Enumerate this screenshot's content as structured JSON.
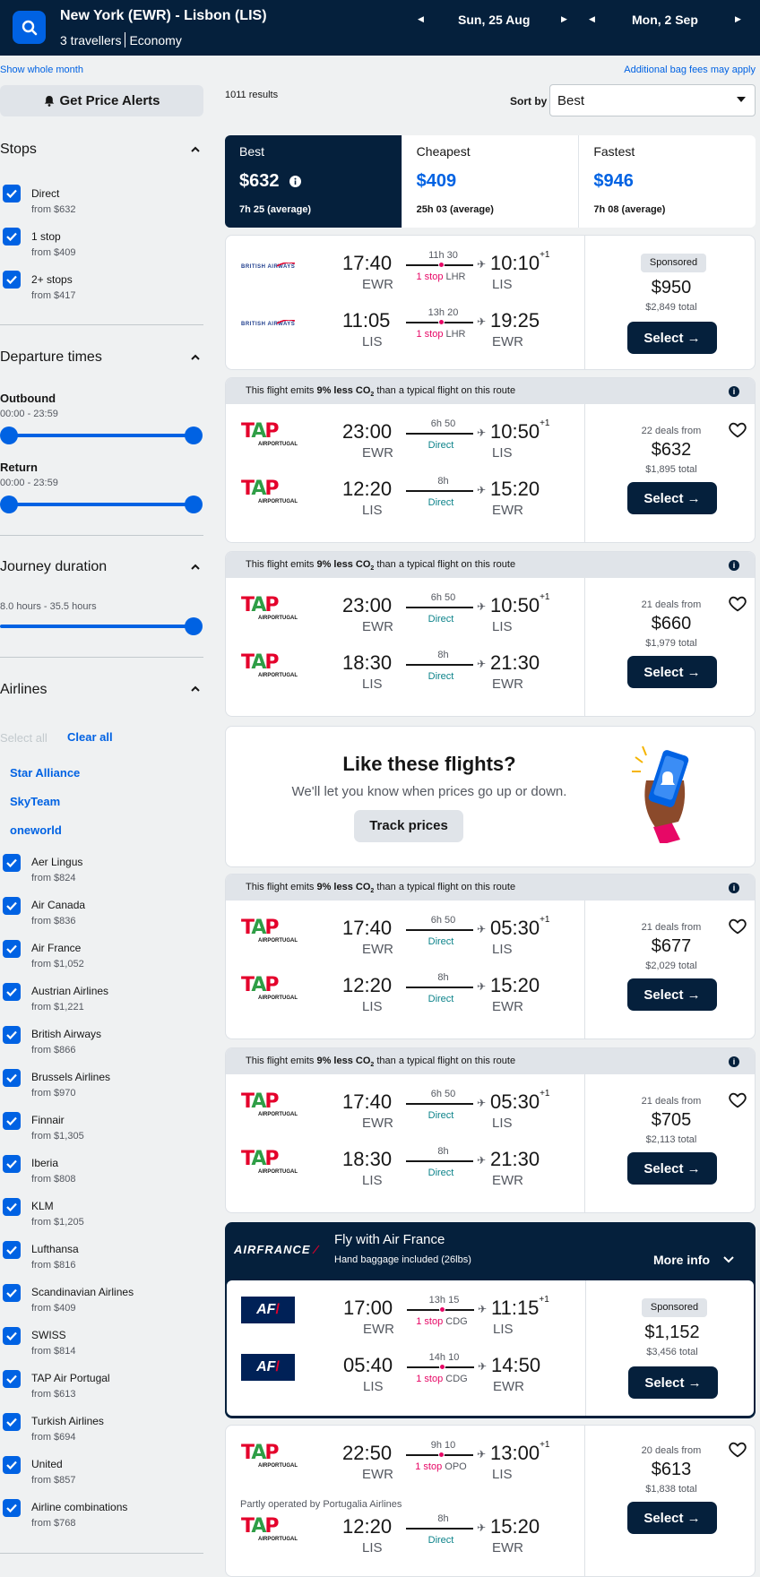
{
  "header": {
    "route": "New York (EWR) - Lisbon (LIS)",
    "travellers": "3 travellers",
    "cabin": "Economy",
    "outbound_date": "Sun, 25 Aug",
    "return_date": "Mon, 2 Sep"
  },
  "links": {
    "show_month": "Show whole month",
    "bag_fees": "Additional bag fees may apply"
  },
  "sidebar": {
    "price_alerts": "Get Price Alerts",
    "stops_title": "Stops",
    "stops": [
      {
        "label": "Direct",
        "sub": "from $632"
      },
      {
        "label": "1 stop",
        "sub": "from $409"
      },
      {
        "label": "2+ stops",
        "sub": "from $417"
      }
    ],
    "departure_title": "Departure times",
    "outbound_label": "Outbound",
    "outbound_range": "00:00 - 23:59",
    "return_label": "Return",
    "return_range": "00:00 - 23:59",
    "duration_title": "Journey duration",
    "duration_range": "8.0 hours - 35.5 hours",
    "airlines_title": "Airlines",
    "select_all": "Select all",
    "clear_all": "Clear all",
    "alliances": [
      "Star Alliance",
      "SkyTeam",
      "oneworld"
    ],
    "airlines": [
      {
        "label": "Aer Lingus",
        "sub": "from $824"
      },
      {
        "label": "Air Canada",
        "sub": "from $836"
      },
      {
        "label": "Air France",
        "sub": "from $1,052"
      },
      {
        "label": "Austrian Airlines",
        "sub": "from $1,221"
      },
      {
        "label": "British Airways",
        "sub": "from $866"
      },
      {
        "label": "Brussels Airlines",
        "sub": "from $970"
      },
      {
        "label": "Finnair",
        "sub": "from $1,305"
      },
      {
        "label": "Iberia",
        "sub": "from $808"
      },
      {
        "label": "KLM",
        "sub": "from $1,205"
      },
      {
        "label": "Lufthansa",
        "sub": "from $816"
      },
      {
        "label": "Scandinavian Airlines",
        "sub": "from $409"
      },
      {
        "label": "SWISS",
        "sub": "from $814"
      },
      {
        "label": "TAP Air Portugal",
        "sub": "from $613"
      },
      {
        "label": "Turkish Airlines",
        "sub": "from $694"
      },
      {
        "label": "United",
        "sub": "from $857"
      },
      {
        "label": "Airline combinations",
        "sub": "from $768"
      }
    ]
  },
  "results": {
    "count": "1011 results",
    "sort_label": "Sort by",
    "sort_value": "Best"
  },
  "tabs": [
    {
      "label": "Best",
      "price": "$632",
      "duration": "7h 25 (average)"
    },
    {
      "label": "Cheapest",
      "price": "$409",
      "duration": "25h 03 (average)"
    },
    {
      "label": "Fastest",
      "price": "$946",
      "duration": "7h 08 (average)"
    }
  ],
  "eco_text": {
    "pre": "This flight emits ",
    "bold": "9% less CO",
    "sub": "2",
    "post": " than a typical flight on this route"
  },
  "cards": [
    {
      "legs": [
        {
          "dep": "17:40",
          "dep_ap": "EWR",
          "dur": "11h 30",
          "stop": "1 stop",
          "via": "LHR",
          "arr": "10:10",
          "arr_sup": "+1",
          "arr_ap": "LIS"
        },
        {
          "dep": "11:05",
          "dep_ap": "LIS",
          "dur": "13h 20",
          "stop": "1 stop",
          "via": "LHR",
          "arr": "19:25",
          "arr_sup": "",
          "arr_ap": "EWR"
        }
      ],
      "sponsored": "Sponsored",
      "price": "$950",
      "total": "$2,849 total",
      "select": "Select"
    },
    {
      "legs": [
        {
          "dep": "23:00",
          "dep_ap": "EWR",
          "dur": "6h 50",
          "stop": "Direct",
          "arr": "10:50",
          "arr_sup": "+1",
          "arr_ap": "LIS"
        },
        {
          "dep": "12:20",
          "dep_ap": "LIS",
          "dur": "8h",
          "stop": "Direct",
          "arr": "15:20",
          "arr_sup": "",
          "arr_ap": "EWR"
        }
      ],
      "deals": "22 deals from",
      "price": "$632",
      "total": "$1,895 total",
      "select": "Select"
    },
    {
      "legs": [
        {
          "dep": "23:00",
          "dep_ap": "EWR",
          "dur": "6h 50",
          "stop": "Direct",
          "arr": "10:50",
          "arr_sup": "+1",
          "arr_ap": "LIS"
        },
        {
          "dep": "18:30",
          "dep_ap": "LIS",
          "dur": "8h",
          "stop": "Direct",
          "arr": "21:30",
          "arr_sup": "",
          "arr_ap": "EWR"
        }
      ],
      "deals": "21 deals from",
      "price": "$660",
      "total": "$1,979 total",
      "select": "Select"
    },
    {
      "legs": [
        {
          "dep": "17:40",
          "dep_ap": "EWR",
          "dur": "6h 50",
          "stop": "Direct",
          "arr": "05:30",
          "arr_sup": "+1",
          "arr_ap": "LIS"
        },
        {
          "dep": "12:20",
          "dep_ap": "LIS",
          "dur": "8h",
          "stop": "Direct",
          "arr": "15:20",
          "arr_sup": "",
          "arr_ap": "EWR"
        }
      ],
      "deals": "21 deals from",
      "price": "$677",
      "total": "$2,029 total",
      "select": "Select"
    },
    {
      "legs": [
        {
          "dep": "17:40",
          "dep_ap": "EWR",
          "dur": "6h 50",
          "stop": "Direct",
          "arr": "05:30",
          "arr_sup": "+1",
          "arr_ap": "LIS"
        },
        {
          "dep": "18:30",
          "dep_ap": "LIS",
          "dur": "8h",
          "stop": "Direct",
          "arr": "21:30",
          "arr_sup": "",
          "arr_ap": "EWR"
        }
      ],
      "deals": "21 deals from",
      "price": "$705",
      "total": "$2,113 total",
      "select": "Select"
    },
    {
      "legs": [
        {
          "dep": "17:00",
          "dep_ap": "EWR",
          "dur": "13h 15",
          "stop": "1 stop",
          "via": "CDG",
          "arr": "11:15",
          "arr_sup": "+1",
          "arr_ap": "LIS"
        },
        {
          "dep": "05:40",
          "dep_ap": "LIS",
          "dur": "14h 10",
          "stop": "1 stop",
          "via": "CDG",
          "arr": "14:50",
          "arr_sup": "",
          "arr_ap": "EWR"
        }
      ],
      "sponsored": "Sponsored",
      "price": "$1,152",
      "total": "$3,456 total",
      "select": "Select"
    },
    {
      "legs": [
        {
          "dep": "22:50",
          "dep_ap": "EWR",
          "dur": "9h 10",
          "stop": "1 stop",
          "via": "OPO",
          "arr": "13:00",
          "arr_sup": "+1",
          "arr_ap": "LIS"
        },
        {
          "dep": "12:20",
          "dep_ap": "LIS",
          "dur": "8h",
          "stop": "Direct",
          "arr": "15:20",
          "arr_sup": "",
          "arr_ap": "EWR"
        }
      ],
      "operated": "Partly operated by Portugalia Airlines",
      "deals": "20 deals from",
      "price": "$613",
      "total": "$1,838 total",
      "select": "Select"
    }
  ],
  "track": {
    "title": "Like these flights?",
    "subtitle": "We'll let you know when prices go up or down.",
    "button": "Track prices"
  },
  "airfrance": {
    "logo": "AIRFRANCE",
    "title": "Fly with Air France",
    "subtitle": "Hand baggage included (26lbs)",
    "more": "More info"
  },
  "logos": {
    "ba": "BRITISH AIRWAYS",
    "tap_sub": "AIRPORTUGAL",
    "af": "AF"
  },
  "colors": {
    "navy": "#05203c",
    "blue": "#0062e3",
    "pink": "#e70866"
  }
}
